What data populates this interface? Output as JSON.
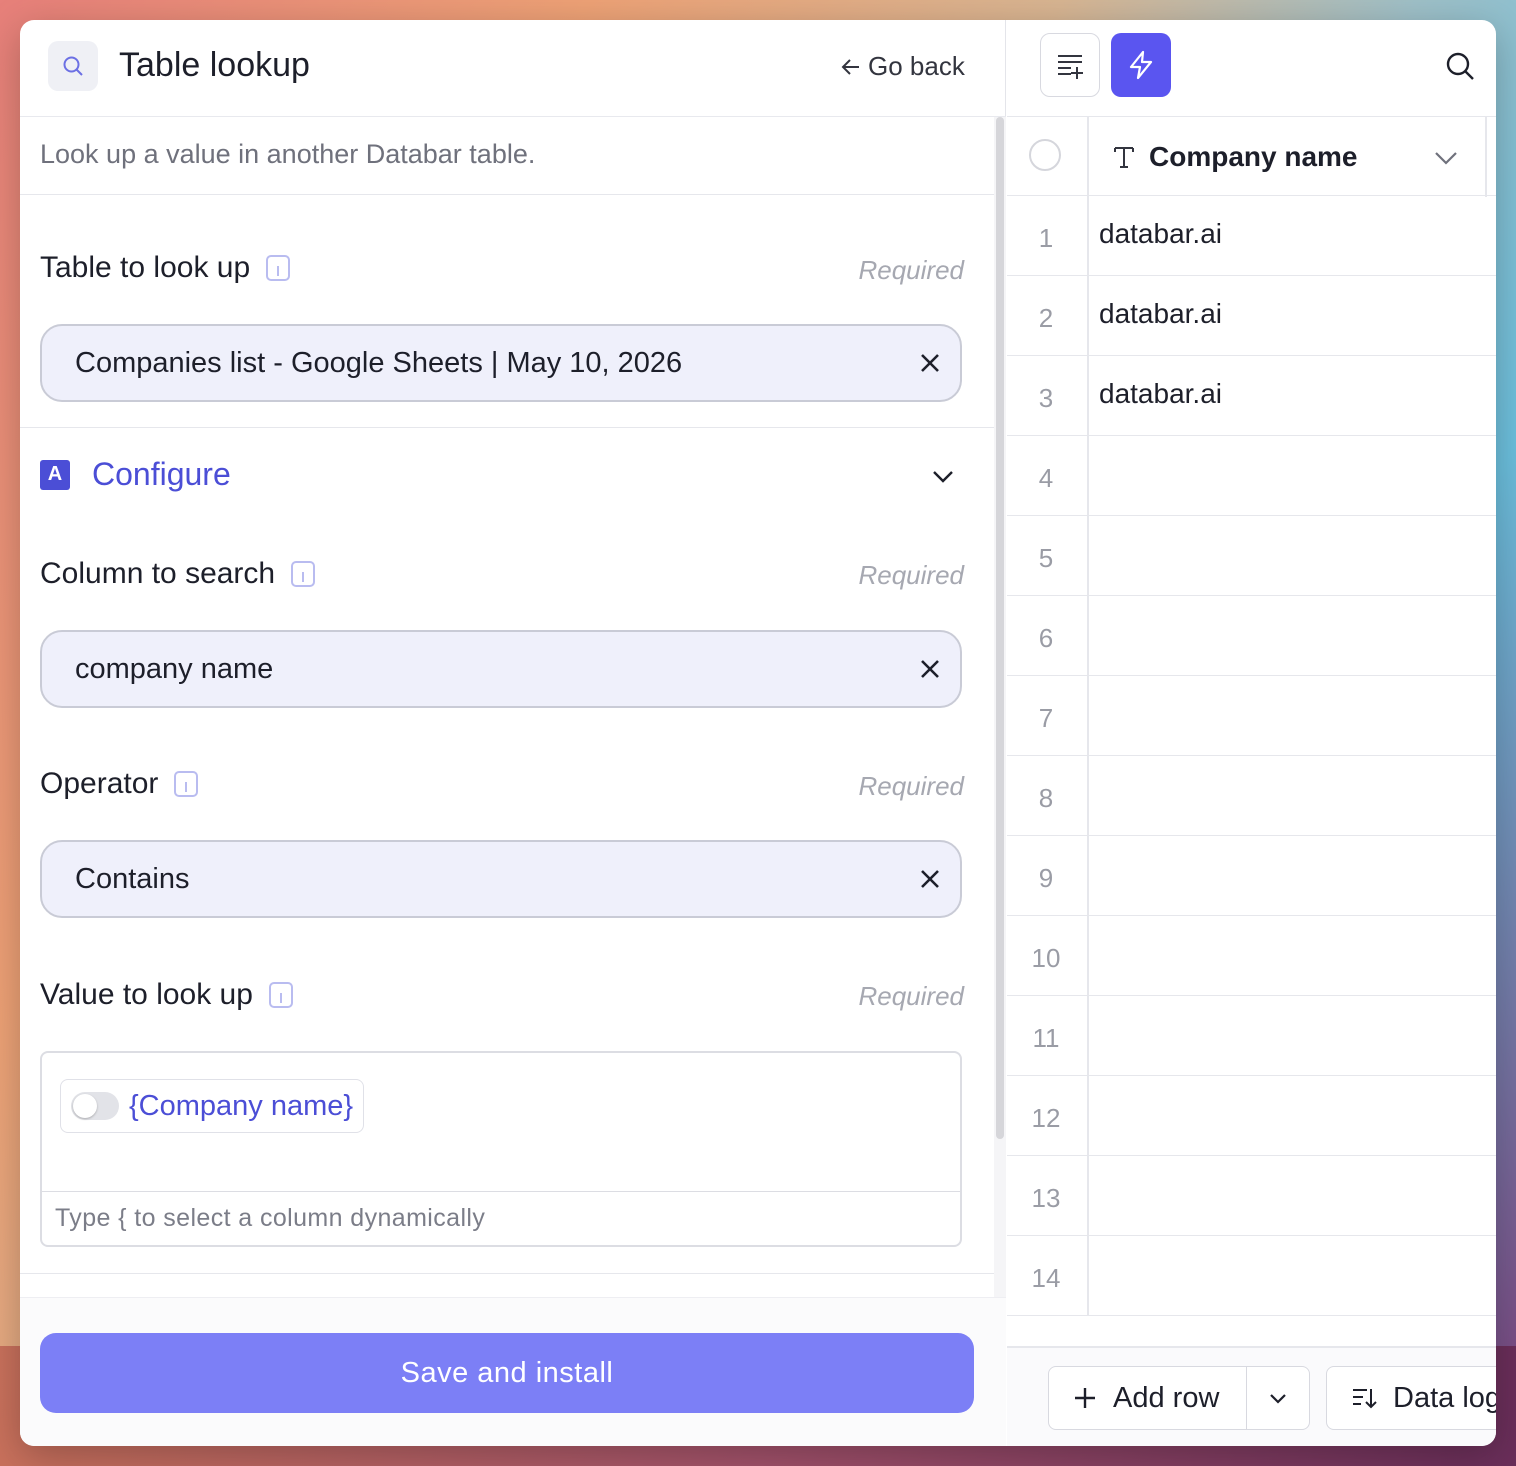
{
  "header": {
    "title": "Table lookup",
    "go_back": "Go back"
  },
  "description": "Look up a value in another Databar table.",
  "fields": {
    "table": {
      "label": "Table to look up",
      "required": "Required",
      "value": "Companies list - Google Sheets | May 10, 2026"
    },
    "configure": "Configure",
    "column": {
      "label": "Column to search",
      "required": "Required",
      "value": "company name"
    },
    "operator": {
      "label": "Operator",
      "required": "Required",
      "value": "Contains"
    },
    "value": {
      "label": "Value to look up",
      "required": "Required",
      "chip": "{Company name}",
      "hint": "Type { to select a column dynamically"
    }
  },
  "footer": {
    "save": "Save and install"
  },
  "grid": {
    "column_header": "Company name",
    "rows": [
      {
        "num": "1",
        "value": "databar.ai"
      },
      {
        "num": "2",
        "value": "databar.ai"
      },
      {
        "num": "3",
        "value": "databar.ai"
      },
      {
        "num": "4",
        "value": ""
      },
      {
        "num": "5",
        "value": ""
      },
      {
        "num": "6",
        "value": ""
      },
      {
        "num": "7",
        "value": ""
      },
      {
        "num": "8",
        "value": ""
      },
      {
        "num": "9",
        "value": ""
      },
      {
        "num": "10",
        "value": ""
      },
      {
        "num": "11",
        "value": ""
      },
      {
        "num": "12",
        "value": ""
      },
      {
        "num": "13",
        "value": ""
      },
      {
        "num": "14",
        "value": ""
      }
    ],
    "add_row": "Add row",
    "data_log": "Data log"
  },
  "colors": {
    "accent": "#4b4ed6",
    "button": "#7c7ff6",
    "bolt": "#5a55f0"
  },
  "icons": [
    "search-icon",
    "arrow-left-icon",
    "info-icon",
    "close-icon",
    "configure-icon",
    "chevron-down-icon",
    "add-column-icon",
    "bolt-icon",
    "text-type-icon",
    "plus-icon",
    "data-log-icon"
  ]
}
